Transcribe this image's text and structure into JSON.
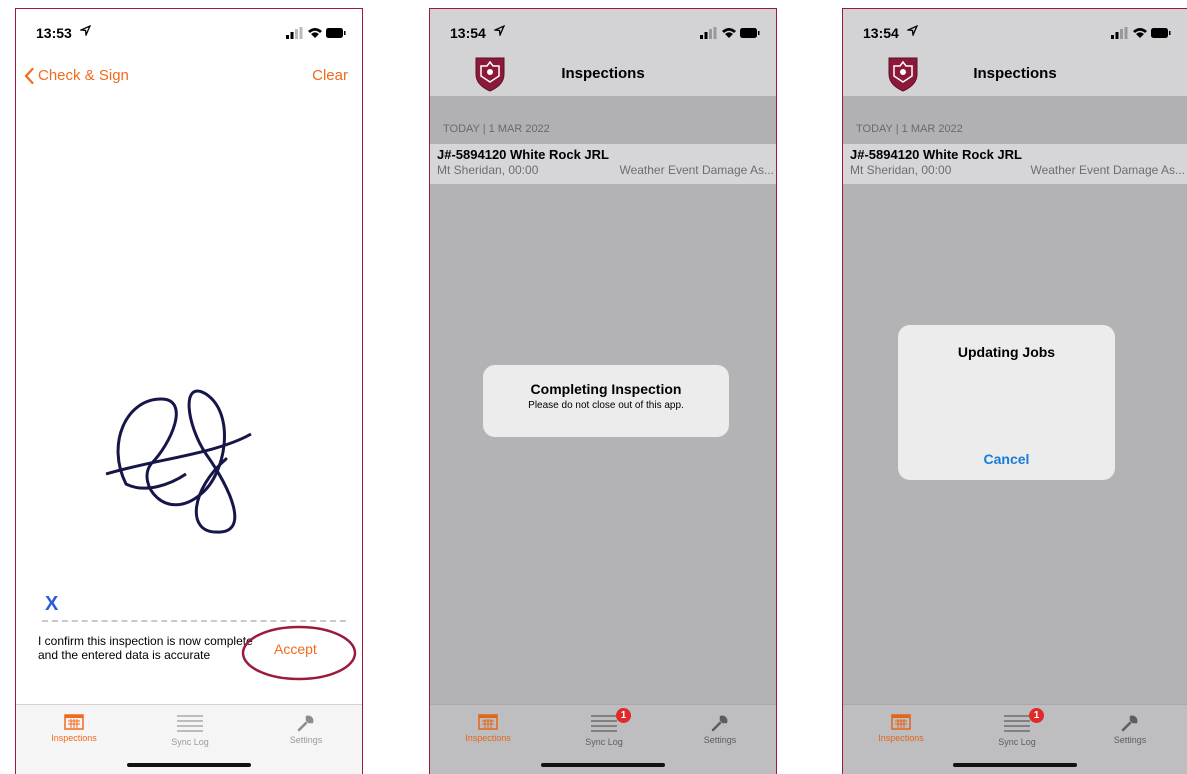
{
  "colors": {
    "accent": "#f26a1b",
    "frame": "#9b1b3d",
    "ink": "#161648",
    "cancel": "#1a7bd6",
    "badge": "#e02a2a"
  },
  "screen1": {
    "time": "13:53",
    "nav": {
      "back_label": "Check & Sign",
      "clear_label": "Clear"
    },
    "signature_mark": "X",
    "confirm_text": "I confirm this inspection is now complete and the entered data is accurate",
    "accept_label": "Accept",
    "tabs": [
      {
        "label": "Inspections",
        "icon": "calendar-icon",
        "active": true
      },
      {
        "label": "Sync Log",
        "icon": "list-icon"
      },
      {
        "label": "Settings",
        "icon": "wrench-icon"
      }
    ]
  },
  "screen2": {
    "time": "13:54",
    "title": "Inspections",
    "section_header": "TODAY | 1 MAR 2022",
    "row": {
      "title": "J#-5894120 White Rock JRL",
      "location": "Mt Sheridan, 00:00",
      "type": "Weather Event Damage As..."
    },
    "alert": {
      "title": "Completing Inspection",
      "message": "Please do not close out of this app."
    },
    "tabs": [
      {
        "label": "Inspections",
        "icon": "calendar-icon",
        "active": true
      },
      {
        "label": "Sync Log",
        "icon": "list-icon",
        "badge": "1"
      },
      {
        "label": "Settings",
        "icon": "wrench-icon"
      }
    ]
  },
  "screen3": {
    "time": "13:54",
    "title": "Inspections",
    "section_header": "TODAY | 1 MAR 2022",
    "row": {
      "title": "J#-5894120 White Rock JRL",
      "location": "Mt Sheridan, 00:00",
      "type": "Weather Event Damage As..."
    },
    "alert": {
      "title": "Updating Jobs",
      "cancel_label": "Cancel"
    },
    "tabs": [
      {
        "label": "Inspections",
        "icon": "calendar-icon",
        "active": true
      },
      {
        "label": "Sync Log",
        "icon": "list-icon",
        "badge": "1"
      },
      {
        "label": "Settings",
        "icon": "wrench-icon"
      }
    ]
  }
}
